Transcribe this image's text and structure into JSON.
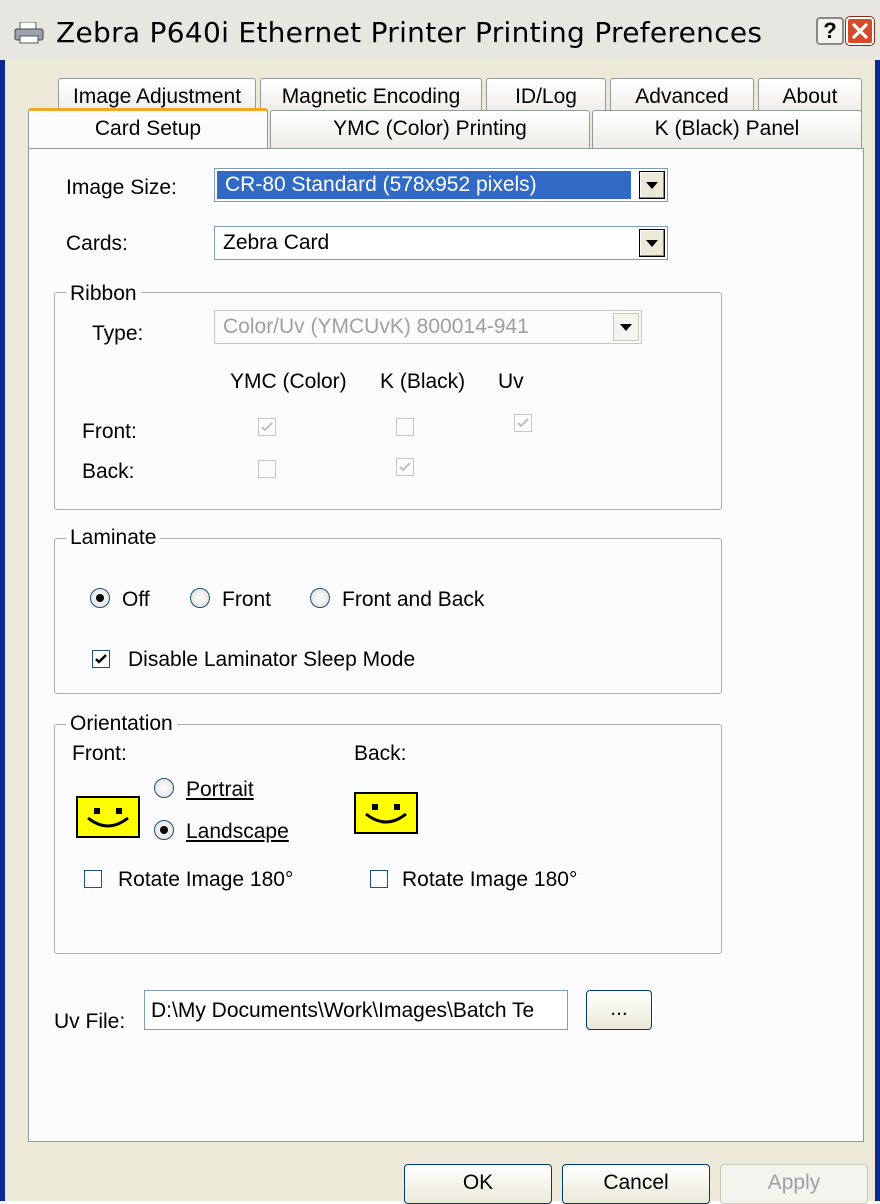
{
  "window": {
    "title": "Zebra P640i Ethernet Printer Printing Preferences",
    "help_label": "?"
  },
  "tabs": {
    "row1": [
      "Image Adjustment",
      "Magnetic Encoding",
      "ID/Log",
      "Advanced",
      "About"
    ],
    "row2": [
      "Card Setup",
      "YMC (Color) Printing",
      "K (Black) Panel"
    ],
    "active": "Card Setup"
  },
  "card_setup": {
    "image_size_label": "Image Size:",
    "image_size_value": "CR-80 Standard (578x952 pixels)",
    "cards_label": "Cards:",
    "cards_value": "Zebra Card"
  },
  "ribbon": {
    "title": "Ribbon",
    "type_label": "Type:",
    "type_value": "Color/Uv (YMCUvK) 800014-941",
    "col_ymc": "YMC (Color)",
    "col_k": "K (Black)",
    "col_uv": "Uv",
    "front_label": "Front:",
    "back_label": "Back:",
    "front": {
      "ymc": true,
      "k": false,
      "uv": true
    },
    "back": {
      "ymc": false,
      "k": true
    }
  },
  "laminate": {
    "title": "Laminate",
    "options": [
      "Off",
      "Front",
      "Front and Back"
    ],
    "selected": "Off",
    "sleep_label": "Disable Laminator Sleep Mode",
    "sleep_checked": true
  },
  "orientation": {
    "title": "Orientation",
    "front_label": "Front:",
    "back_label": "Back:",
    "portrait_label": "Portrait",
    "landscape_label": "Landscape",
    "selected": "Landscape",
    "rotate_front_label": "Rotate Image 180°",
    "rotate_back_label": "Rotate Image 180°",
    "rotate_front_checked": false,
    "rotate_back_checked": false
  },
  "uv_file": {
    "label": "Uv File:",
    "value": "D:\\My Documents\\Work\\Images\\Batch Te",
    "browse_label": "..."
  },
  "buttons": {
    "ok": "OK",
    "cancel": "Cancel",
    "apply": "Apply"
  },
  "colors": {
    "accent_tab": "#f5a623",
    "smiley": "#ffff00",
    "frame": "#0a2a8f"
  }
}
